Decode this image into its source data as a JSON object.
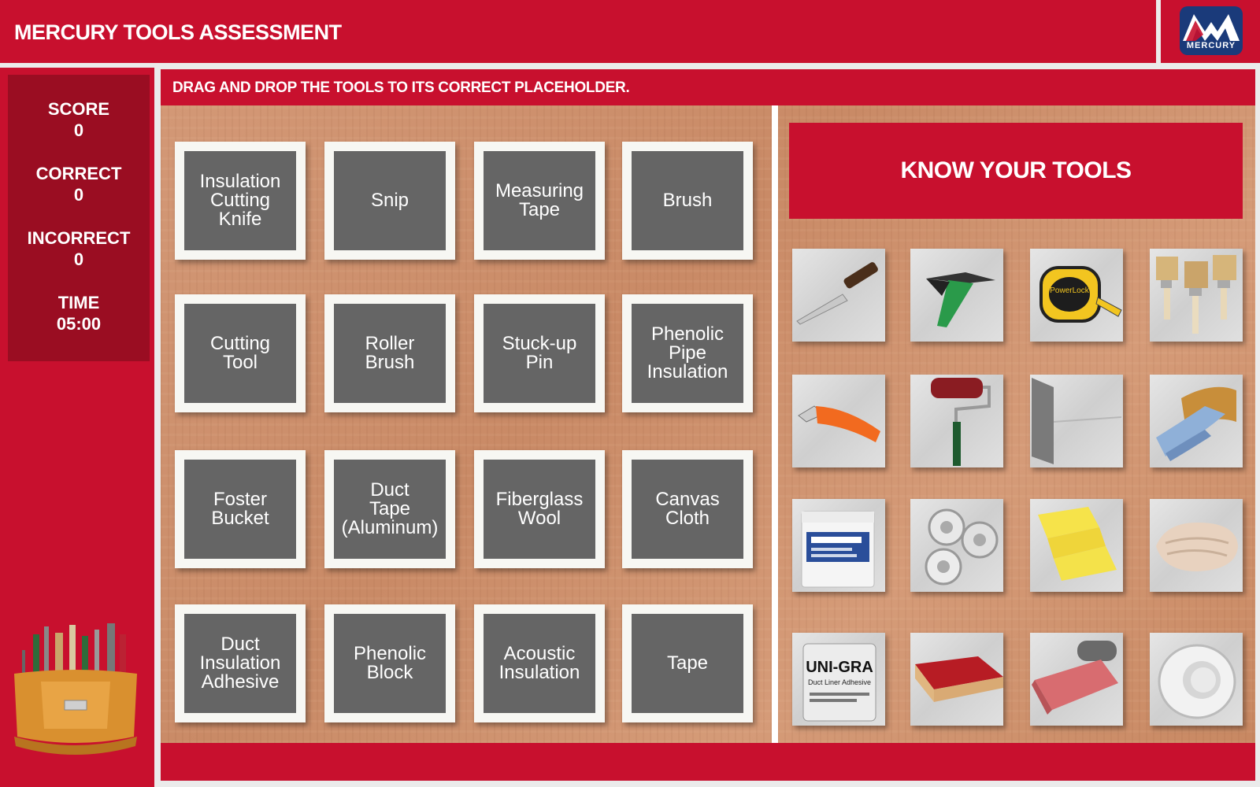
{
  "header": {
    "title": "MERCURY TOOLS ASSESSMENT",
    "logo_text": "MERCURY"
  },
  "scoreboard": {
    "score_label": "SCORE",
    "score_value": "0",
    "correct_label": "CORRECT",
    "correct_value": "0",
    "incorrect_label": "INCORRECT",
    "incorrect_value": "0",
    "time_label": "TIME",
    "time_value": "05:00"
  },
  "instructions": "DRAG AND DROP THE TOOLS TO ITS CORRECT PLACEHOLDER.",
  "slots": [
    "Insulation\nCutting\nKnife",
    "Snip",
    "Measuring\nTape",
    "Brush",
    "Cutting\nTool",
    "Roller\nBrush",
    "Stuck-up\nPin",
    "Phenolic\nPipe\nInsulation",
    "Foster\nBucket",
    "Duct\nTape\n(Aluminum)",
    "Fiberglass\nWool",
    "Canvas\nCloth",
    "Duct\nInsulation\nAdhesive",
    "Phenolic\nBlock",
    "Acoustic\nInsulation",
    "Tape"
  ],
  "tools_panel": {
    "title": "KNOW YOUR TOOLS"
  },
  "tools": [
    "knife-icon",
    "snip-icon",
    "measuring-tape-icon",
    "brush-icon",
    "cutting-tool-icon",
    "roller-brush-icon",
    "stuck-up-pin-icon",
    "pipe-insulation-icon",
    "bucket-icon",
    "aluminum-tape-icon",
    "fiberglass-wool-icon",
    "canvas-cloth-icon",
    "adhesive-can-icon",
    "phenolic-block-icon",
    "acoustic-insulation-icon",
    "tape-roll-icon"
  ],
  "tool_texts": {
    "measuring_tape_brand": "PowerLock",
    "adhesive_brand": "UNI-GRA",
    "adhesive_sub": "Duct Liner Adhesive"
  },
  "colors": {
    "brand_red": "#c8102e",
    "dark_red": "#9a0d22",
    "slot_gray": "#656565",
    "logo_blue": "#1a3a7a"
  }
}
